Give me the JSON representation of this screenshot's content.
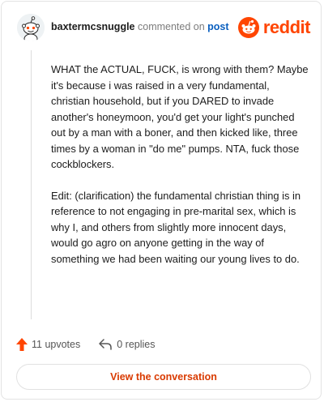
{
  "header": {
    "username": "baxtermcsnuggle",
    "action_text": " commented on ",
    "post_link": "post",
    "brand": "reddit"
  },
  "comment": {
    "paragraphs": [
      "WHAT the ACTUAL, FUCK, is wrong with them? Maybe it's because i was raised in a very fundamental, christian household, but if you DARED to invade another's honeymoon, you'd get your light's punched out by a man with a boner, and then kicked like, three times by a woman in \"do me\" pumps. NTA, fuck those cockblockers.",
      "Edit: (clarification) the fundamental christian thing is in reference to not engaging in pre-marital sex, which is why I, and others from slightly more innocent days, would go agro on anyone getting in the way of something we had been waiting our young lives to do."
    ]
  },
  "footer": {
    "upvotes_label": "11 upvotes",
    "replies_label": "0 replies",
    "upvote_icon": "upvote-arrow-icon",
    "reply_icon": "reply-arrow-icon"
  },
  "cta": {
    "label": "View the conversation"
  },
  "colors": {
    "brand": "#ff4500",
    "link": "#0a5fbf",
    "cta_text": "#d93a00"
  }
}
